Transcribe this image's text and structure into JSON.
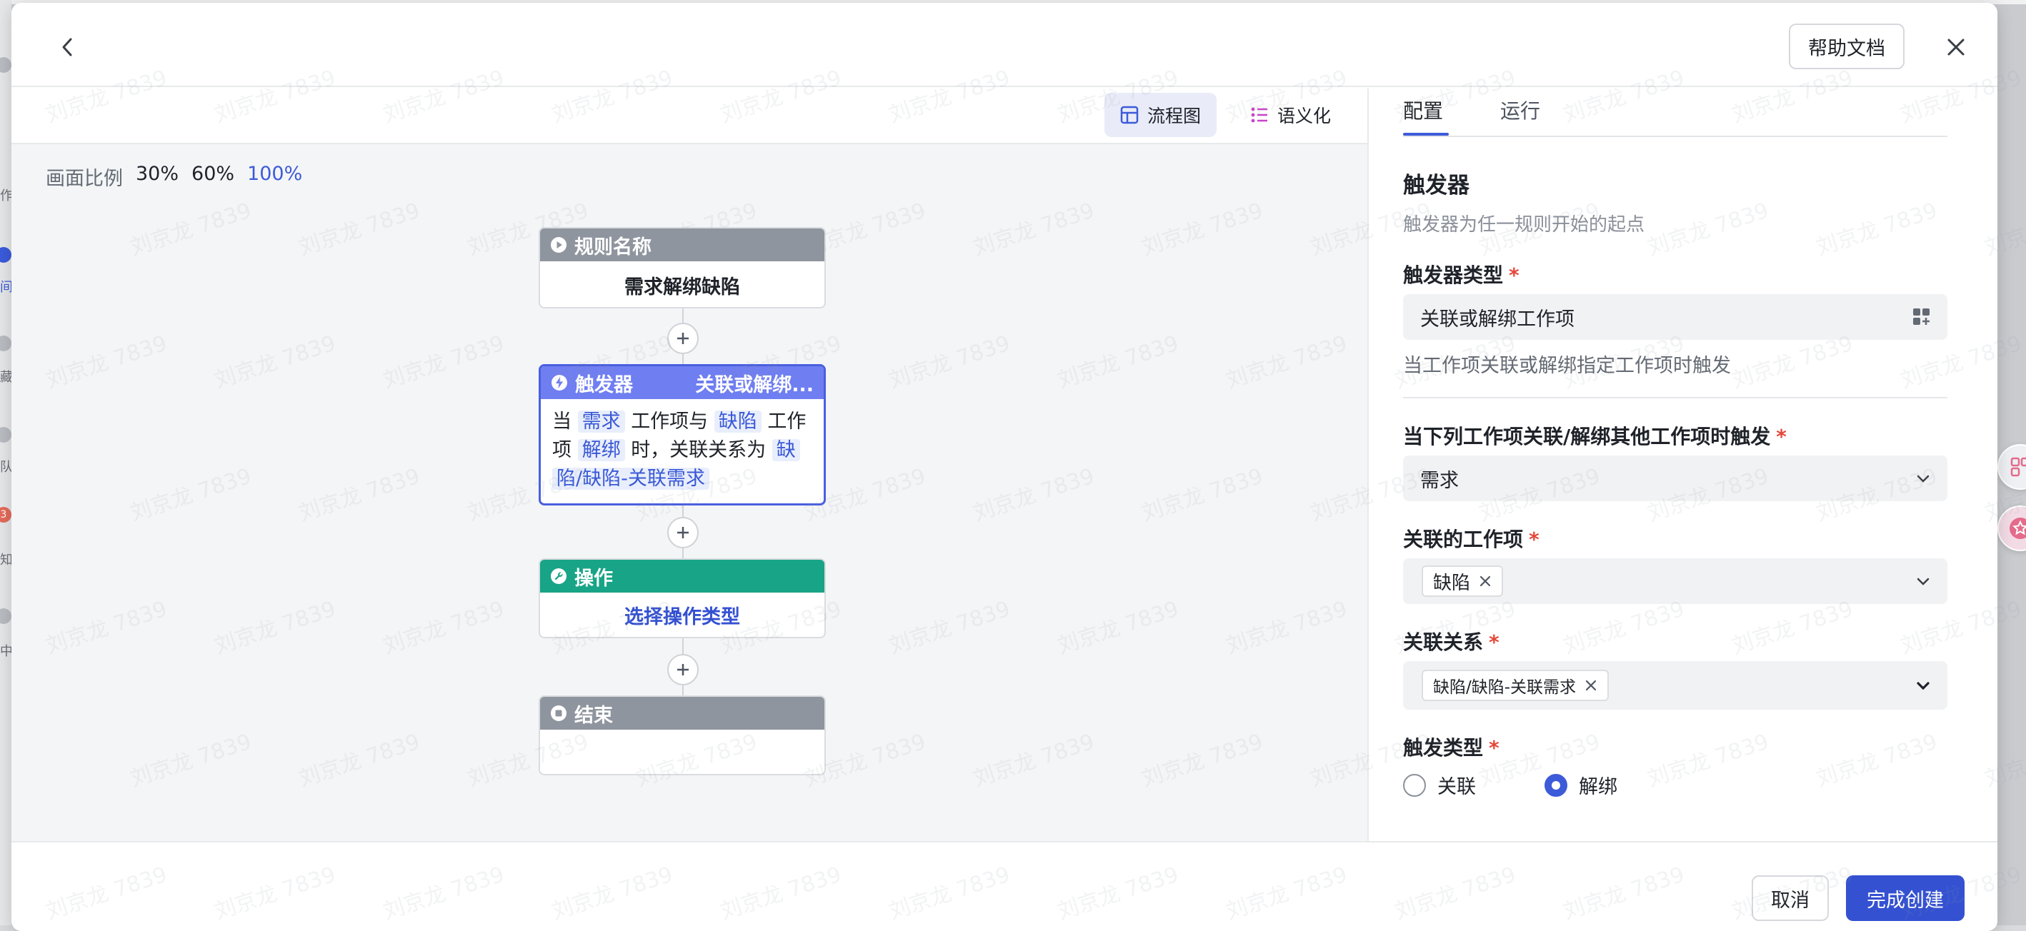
{
  "header": {
    "help_label": "帮助文档"
  },
  "canvas": {
    "view_tabs": [
      {
        "label": "流程图",
        "active": true,
        "icon": "flowchart-icon"
      },
      {
        "label": "语义化",
        "active": false,
        "icon": "list-icon"
      }
    ],
    "ratio_label": "画面比例",
    "ratio_options": [
      "30%",
      "60%",
      "100%"
    ],
    "ratio_selected": "100%",
    "nodes": {
      "rule": {
        "title": "规则名称",
        "body": "需求解绑缺陷",
        "color": "#8f959e"
      },
      "trigger": {
        "title": "触发器",
        "title_right": "关联或解绑...",
        "color": "#6f7ef1",
        "text": {
          "p1": "当",
          "tag1": "需求",
          "p2": "工作项与",
          "tag2": "缺陷",
          "p3": "工作",
          "p4": "项",
          "tag3": "解绑",
          "p5": "时，关联关系为",
          "tag4a": "缺",
          "tag4b": "陷/缺陷-关联需求"
        }
      },
      "action": {
        "title": "操作",
        "body": "选择操作类型",
        "color": "#18a486"
      },
      "end": {
        "title": "结束",
        "color": "#8f959e"
      }
    }
  },
  "settings": {
    "tabs": [
      {
        "label": "配置",
        "active": true
      },
      {
        "label": "运行",
        "active": false
      }
    ],
    "section_title": "触发器",
    "section_desc": "触发器为任一规则开始的起点",
    "trigger_type": {
      "label": "触发器类型",
      "required": "*",
      "value": "关联或解绑工作项",
      "hint": "当工作项关联或解绑指定工作项时触发"
    },
    "source_item": {
      "label": "当下列工作项关联/解绑其他工作项时触发",
      "required": "*",
      "value": "需求"
    },
    "related_item": {
      "label": "关联的工作项",
      "required": "*",
      "chip": "缺陷"
    },
    "relation": {
      "label": "关联关系",
      "required": "*",
      "chip": "缺陷/缺陷-关联需求"
    },
    "trigger_kind": {
      "label": "触发类型",
      "required": "*",
      "options": [
        {
          "label": "关联",
          "checked": false
        },
        {
          "label": "解绑",
          "checked": true
        }
      ]
    }
  },
  "footer": {
    "cancel_label": "取消",
    "create_label": "完成创建"
  },
  "watermark": "刘京龙 7839",
  "background": {
    "badge_count": "3",
    "fragments": [
      "作",
      "间",
      "藏",
      "队",
      "知",
      "中"
    ]
  },
  "colors": {
    "primary": "#3451d1",
    "link": "#3d5bd9",
    "trigger_node": "#6f7ef1",
    "action_node": "#18a486",
    "neutral_node": "#8f959e",
    "required": "#e5483a"
  }
}
